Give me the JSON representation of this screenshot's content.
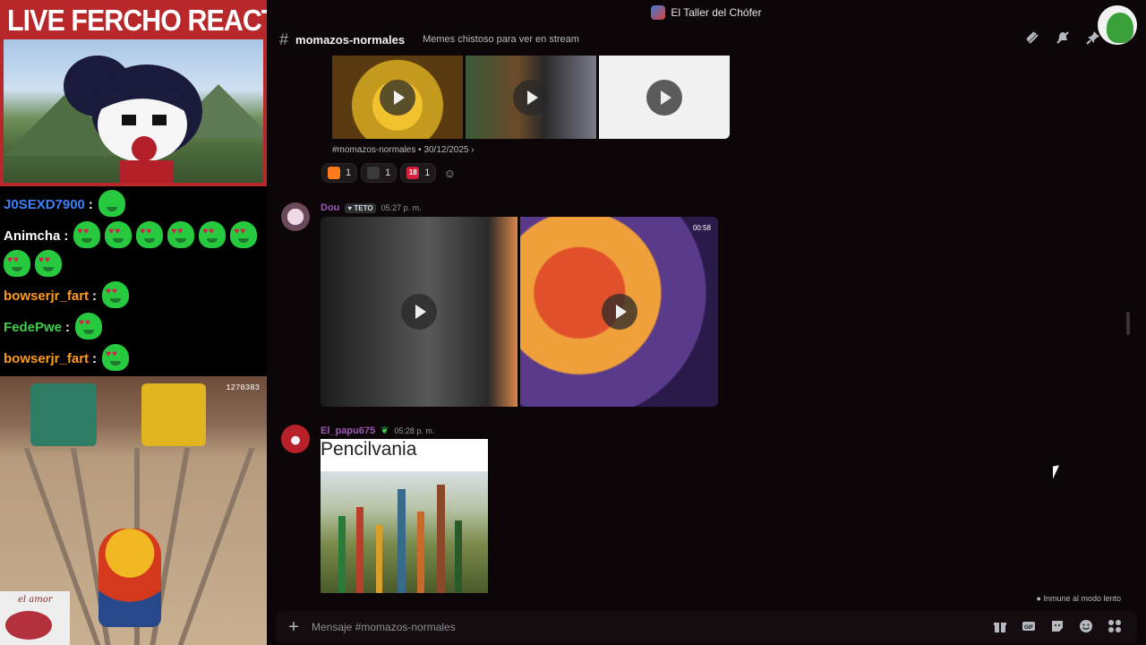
{
  "stream": {
    "cam_title": "LIVE FERCHO REACTION",
    "chat": [
      {
        "user": "J0SEXD7900",
        "color": "#3b82f6",
        "emotes": 1
      },
      {
        "user": "Animcha",
        "color": "#ffffff",
        "emotes": 8
      },
      {
        "user": "bowserjr_fart",
        "color": "#ff9a1a",
        "emotes": 1
      },
      {
        "user": "FedePwe",
        "color": "#3ecf4c",
        "emotes": 1
      },
      {
        "user": "bowserjr_fart",
        "color": "#ff9a1a",
        "emotes": 1
      }
    ],
    "game_score": "1270383",
    "sticker_text": "el amor"
  },
  "app": {
    "server_name": "El Taller del Chófer"
  },
  "channel": {
    "hash": "#",
    "name": "momazos-normales",
    "topic": "Memes chistoso para ver en stream",
    "icons": [
      "threads-icon",
      "mute-icon",
      "pin-icon"
    ]
  },
  "messages": {
    "forward_channel": "#momazos-normales",
    "forward_date": "30/12/2025",
    "reactions": [
      {
        "icon": "fire",
        "count": "1",
        "color": "#ff7a1a"
      },
      {
        "icon": "sticker",
        "count": "1",
        "color": "#3a3a3a"
      },
      {
        "icon": "18",
        "count": "1",
        "color": "#d4203a"
      }
    ],
    "msg1": {
      "user": "Dou",
      "tag": "TETO",
      "time": "05:27 p. m.",
      "video_time": "00:58"
    },
    "msg2": {
      "user": "El_papu675",
      "time": "05:28 p. m.",
      "image_caption": "Pencilvania"
    }
  },
  "composer": {
    "slow_mode": "Inmune al modo lento",
    "placeholder": "Mensaje #momazos-normales",
    "icons": [
      "gift-icon",
      "gif-icon",
      "sticker-icon",
      "emoji-icon",
      "apps-icon"
    ]
  },
  "colors": {
    "background": "#0d0608",
    "username_purple": "#9b59b6",
    "accent": "#5865f2"
  }
}
